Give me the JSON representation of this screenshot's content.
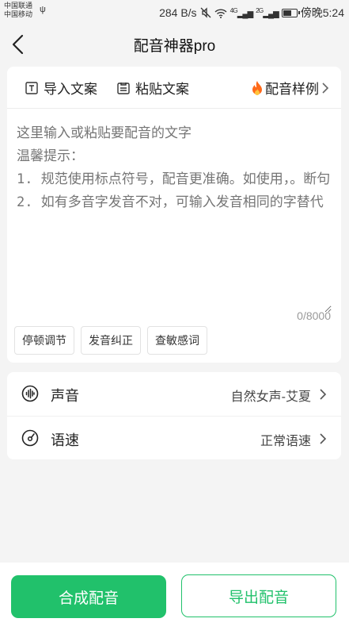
{
  "status_bar": {
    "carrier_1": "中国联通",
    "carrier_2": "中国移动",
    "speed": "284 B/s",
    "signal_1": "4G",
    "signal_2": "2G",
    "time": "傍晚5:24"
  },
  "nav": {
    "title": "配音神器pro"
  },
  "toolbar": {
    "import_label": "导入文案",
    "paste_label": "粘贴文案",
    "sample_label": "配音样例"
  },
  "editor": {
    "placeholder": "这里输入或粘贴要配音的文字\n温馨提示：\n1. 规范使用标点符号，配音更准确。如使用，。断句\n2. 如有多音字发音不对，可输入发音相同的字替代",
    "counter": "0/8000"
  },
  "chips": {
    "pause": "停顿调节",
    "pronunciation": "发音纠正",
    "sensitive": "查敏感词"
  },
  "settings": {
    "voice_label": "声音",
    "voice_value": "自然女声-艾夏",
    "speed_label": "语速",
    "speed_value": "正常语速"
  },
  "actions": {
    "synthesize": "合成配音",
    "export": "导出配音"
  },
  "colors": {
    "accent": "#21c16b",
    "background": "#f4f4f4",
    "placeholder": "#bdbdbd"
  }
}
